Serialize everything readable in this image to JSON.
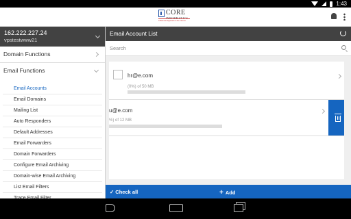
{
  "status_bar": {
    "time": "1:43"
  },
  "logo": {
    "name": "CORE",
    "sub": "INFORMATICS",
    "tagline": "A Business Approach to the Internet"
  },
  "sidebar": {
    "server_ip": "162.222.227.24",
    "server_host": "vpstestwww21",
    "sections": [
      {
        "label": "Domain Functions"
      },
      {
        "label": "Email Functions"
      }
    ],
    "menu_items": [
      "Email Accounts",
      "Email Domains",
      "Mailing List",
      "Auto Responders",
      "Default Addresses",
      "Email Forwarders",
      "Domain Forwarders",
      "Configure Email Archiving",
      "Domain-wise Email Archiving",
      "List Email Filters",
      "Trace Email Filter"
    ],
    "active_item": "Email Accounts"
  },
  "main": {
    "title": "Email Account List",
    "search_placeholder": "Search",
    "accounts": [
      {
        "email": "hr@e.com",
        "usage_text": "(0%) of 50 MB",
        "usage_percent": 0
      },
      {
        "email": "u@e.com",
        "usage_text": "%) of 12 MB",
        "usage_percent": 0
      }
    ]
  },
  "footer": {
    "check_all": "Check all",
    "add": "Add"
  },
  "colors": {
    "accent": "#1565c0",
    "dark": "#424242"
  }
}
